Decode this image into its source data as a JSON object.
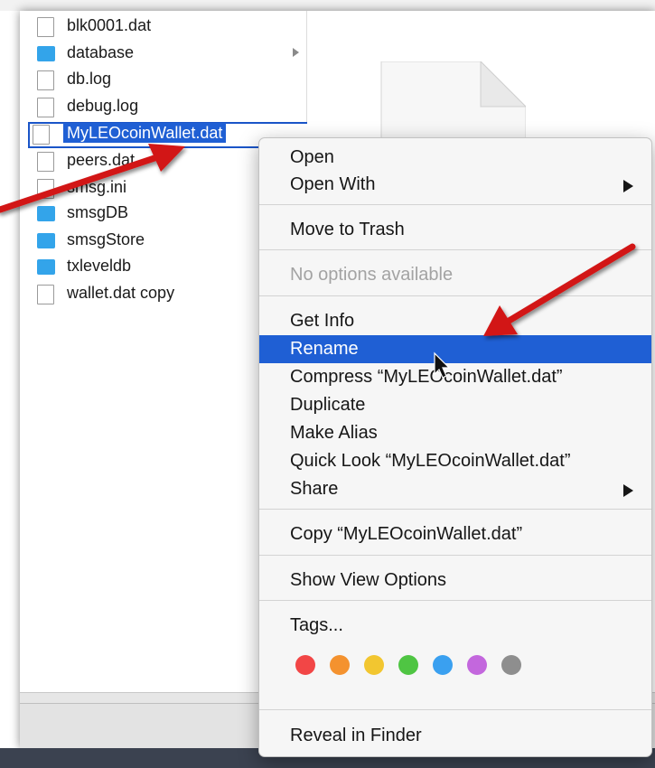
{
  "finder": {
    "files": [
      {
        "name": "blk0001.dat",
        "type": "doc",
        "icon": "document-icon"
      },
      {
        "name": "database",
        "type": "folder",
        "icon": "folder-icon",
        "has_children": true
      },
      {
        "name": "db.log",
        "type": "doc",
        "icon": "document-icon"
      },
      {
        "name": "debug.log",
        "type": "doc",
        "icon": "document-icon"
      },
      {
        "name": "MyLEOcoinWallet.dat",
        "type": "doc",
        "icon": "document-icon",
        "selected": true
      },
      {
        "name": "peers.dat",
        "type": "doc",
        "icon": "document-icon"
      },
      {
        "name": "smsg.ini",
        "type": "doc",
        "icon": "document-icon"
      },
      {
        "name": "smsgDB",
        "type": "folder",
        "icon": "folder-icon"
      },
      {
        "name": "smsgStore",
        "type": "folder",
        "icon": "folder-icon"
      },
      {
        "name": "txleveldb",
        "type": "folder",
        "icon": "folder-icon"
      },
      {
        "name": "wallet.dat copy",
        "type": "doc",
        "icon": "document-icon"
      }
    ]
  },
  "context_menu": {
    "items": [
      {
        "label": "Open"
      },
      {
        "label": "Open With",
        "submenu": true
      },
      {
        "label": "Move to Trash"
      },
      {
        "label": "No options available",
        "disabled": true
      },
      {
        "label": "Get Info"
      },
      {
        "label": "Rename",
        "highlighted": true
      },
      {
        "label": "Compress “MyLEOcoinWallet.dat”"
      },
      {
        "label": "Duplicate"
      },
      {
        "label": "Make Alias"
      },
      {
        "label": "Quick Look “MyLEOcoinWallet.dat”"
      },
      {
        "label": "Share",
        "submenu": true
      },
      {
        "label": "Copy “MyLEOcoinWallet.dat”"
      },
      {
        "label": "Show View Options"
      },
      {
        "label": "Tags..."
      },
      {
        "label": "Reveal in Finder"
      }
    ],
    "tag_colors": [
      "#f24646",
      "#f4922f",
      "#f2c630",
      "#4fc543",
      "#3aa0f0",
      "#c367dd",
      "#8e8e8e"
    ]
  },
  "colors": {
    "selection": "#1f5fd4",
    "arrow": "#d21414",
    "folder": "#33a4ea"
  }
}
